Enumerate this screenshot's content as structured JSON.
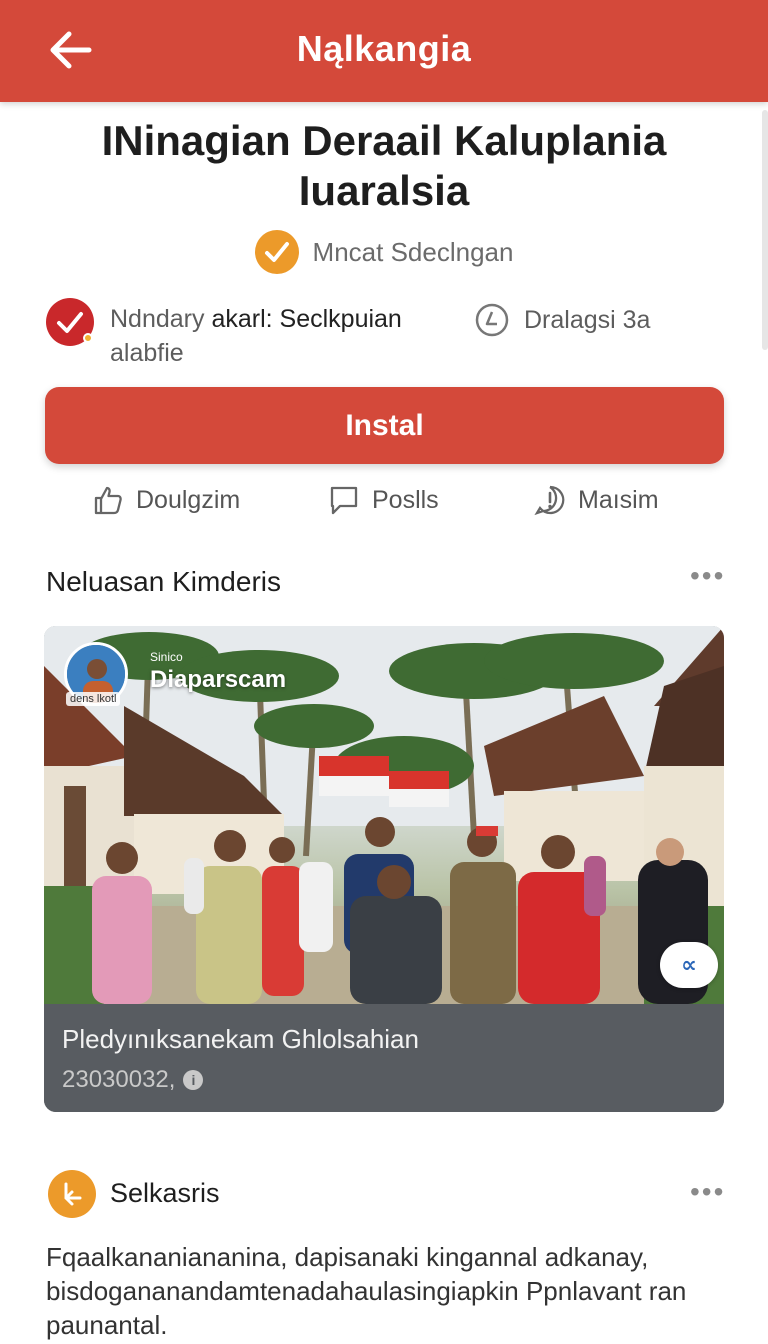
{
  "header": {
    "title": "Nąlkangia",
    "back_icon": "arrow-left-icon"
  },
  "app": {
    "title": "INinagian Deraail Kaluplania Iuaralsia",
    "developer": "Mncat Sdeclngan",
    "developer_badge_color": "#ec9a2a"
  },
  "meta": {
    "rating_prefix": "Ndndary",
    "rating_highlight": "akarl: Seclkpuian",
    "rating_suffix": "alabfie",
    "right_label": "Dralagsi 3a"
  },
  "install_label": "Instal",
  "actions": [
    {
      "label": "Doulgzim",
      "icon": "thumbs-up-icon"
    },
    {
      "label": "Poslls",
      "icon": "comment-icon"
    },
    {
      "label": "Maısim",
      "icon": "alert-icon"
    }
  ],
  "section": {
    "title": "Neluasan Kimderis",
    "menu": "•••"
  },
  "card": {
    "channel_small": "Sinico",
    "channel_name": "Diaparscam",
    "channel_tag": "dens lkotl",
    "caption": "Pledyınıksanekam Ghlolsahian",
    "date": "23030032,",
    "share_label": "∝"
  },
  "review": {
    "author": "Selkasris",
    "menu": "•••",
    "text": "Fqaalkananiananina, dapisanaki kingannal adkanay, bisdogananandamtenadahaulasingiapkin Ppnlavant ran paunantal."
  },
  "colors": {
    "primary": "#d4493a",
    "accent_orange": "#ec9a2a",
    "badge_red": "#c9282b"
  }
}
